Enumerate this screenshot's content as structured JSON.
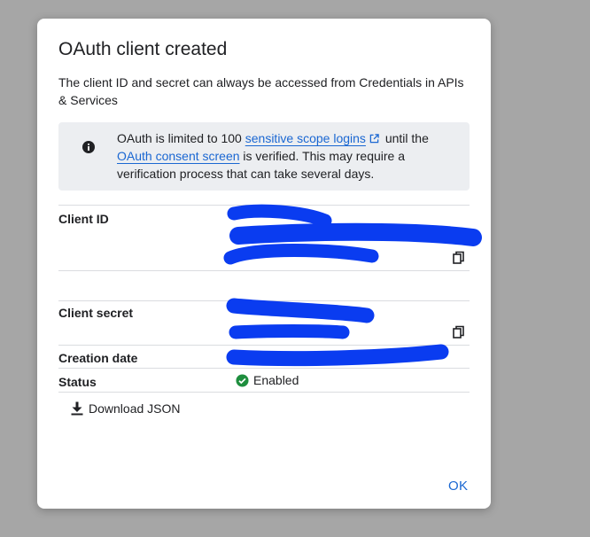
{
  "dialog": {
    "title": "OAuth client created",
    "description": "The client ID and secret can always be accessed from Credentials in APIs & Services",
    "notice": {
      "icon": "info-icon",
      "text_before": "OAuth is limited to 100 ",
      "link1": "sensitive scope logins",
      "link1_icon": "external-link-icon",
      "text_middle": " until the ",
      "link2": "OAuth consent screen",
      "text_after": " is verified. This may require a verification process that can take several days."
    },
    "fields": {
      "client_id_label": "Client ID",
      "client_secret_label": "Client secret",
      "creation_date_label": "Creation date",
      "status_label": "Status",
      "status_value": "Enabled",
      "status_icon": "check-circle-icon",
      "copy_icon": "copy-icon"
    },
    "download_label": "Download JSON",
    "download_icon": "download-icon",
    "ok_label": "OK"
  },
  "colors": {
    "backdrop": "#a6a6a6",
    "link": "#1a67d2",
    "status_ok": "#1e8e3e",
    "redaction": "#0a3cf0",
    "info_box": "#eceef1"
  }
}
